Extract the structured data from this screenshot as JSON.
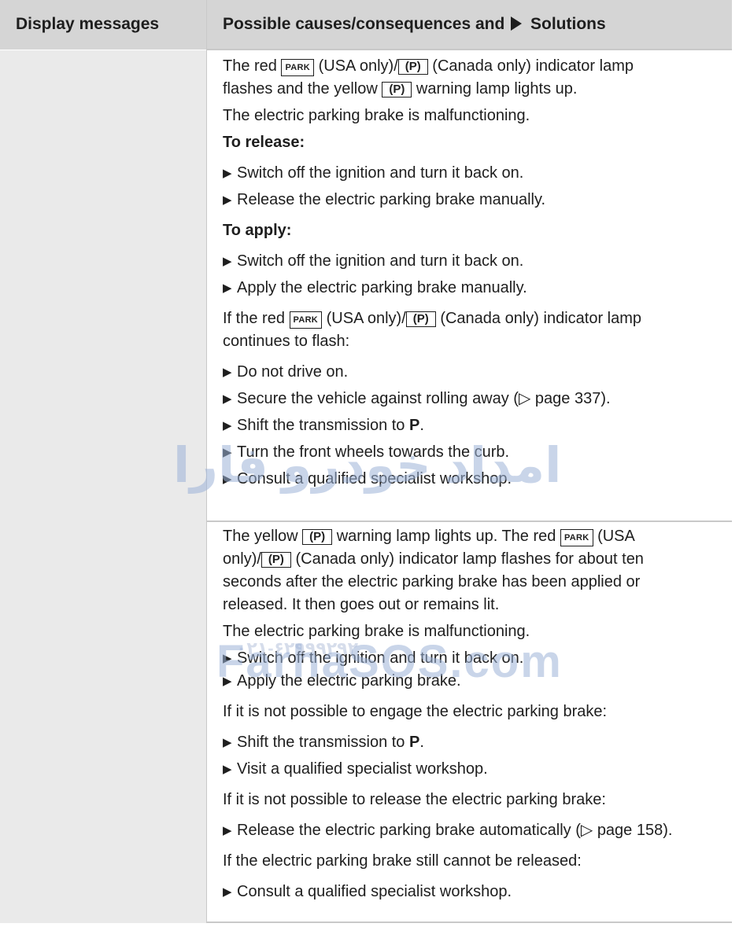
{
  "header": {
    "col1": "Display messages",
    "col2_a": "Possible causes/consequences and",
    "col2_b": "Solutions"
  },
  "keys": {
    "park": "PARK",
    "p": "(P)"
  },
  "row1": {
    "l1_a": "The red ",
    "l1_b": " (USA only)/",
    "l1_c": " (Canada only) indicator lamp",
    "l2_a": "flashes and the yellow ",
    "l2_b": " warning lamp lights up.",
    "malfunction": "The electric parking brake is malfunctioning.",
    "release_heading": "To release:",
    "release_steps": [
      "Switch off the ignition and turn it back on.",
      "Release the electric parking brake manually."
    ],
    "apply_heading": "To apply:",
    "apply_steps": [
      "Switch off the ignition and turn it back on.",
      "Apply the electric parking brake manually."
    ],
    "cont_a": "If the red ",
    "cont_b": " (USA only)/",
    "cont_c": " (Canada only) indicator lamp",
    "cont_d": "continues to flash:",
    "final_steps": [
      "Do not drive on.",
      "Secure the vehicle against rolling away (▷ page 337).",
      "Shift the transmission to ",
      "Turn the front wheels towards the curb.",
      "Consult a qualified specialist workshop."
    ],
    "shift_bold": "P",
    "shift_end": "."
  },
  "row2": {
    "l1_a": "The yellow ",
    "l1_b": " warning lamp lights up. The red ",
    "l1_c": " (USA",
    "l2_a": "only)/",
    "l2_b": " (Canada only) indicator lamp flashes for about ten",
    "l3": "seconds after the electric parking brake has been applied or",
    "l4": "released. It then goes out or remains lit.",
    "malfunction": "The electric parking brake is malfunctioning.",
    "steps1": [
      "Switch off the ignition and turn it back on.",
      "Apply the electric parking brake."
    ],
    "not_engage": "If it is not possible to engage the electric parking brake:",
    "shift_text": "Shift the transmission to ",
    "shift_bold": "P",
    "shift_end": ".",
    "visit": "Visit a qualified specialist workshop.",
    "not_release": "If it is not possible to release the electric parking brake:",
    "release_auto": "Release the electric parking brake automatically (▷ page 158).",
    "still": "If the electric parking brake still cannot be released:",
    "consult": "Consult a qualified specialist workshop."
  },
  "watermark": {
    "persian": "امداد خودرو فارا",
    "phone": "۰۲۱-۶۲۹۹۹۲۹۲",
    "site": "FarhaSOS.com"
  }
}
